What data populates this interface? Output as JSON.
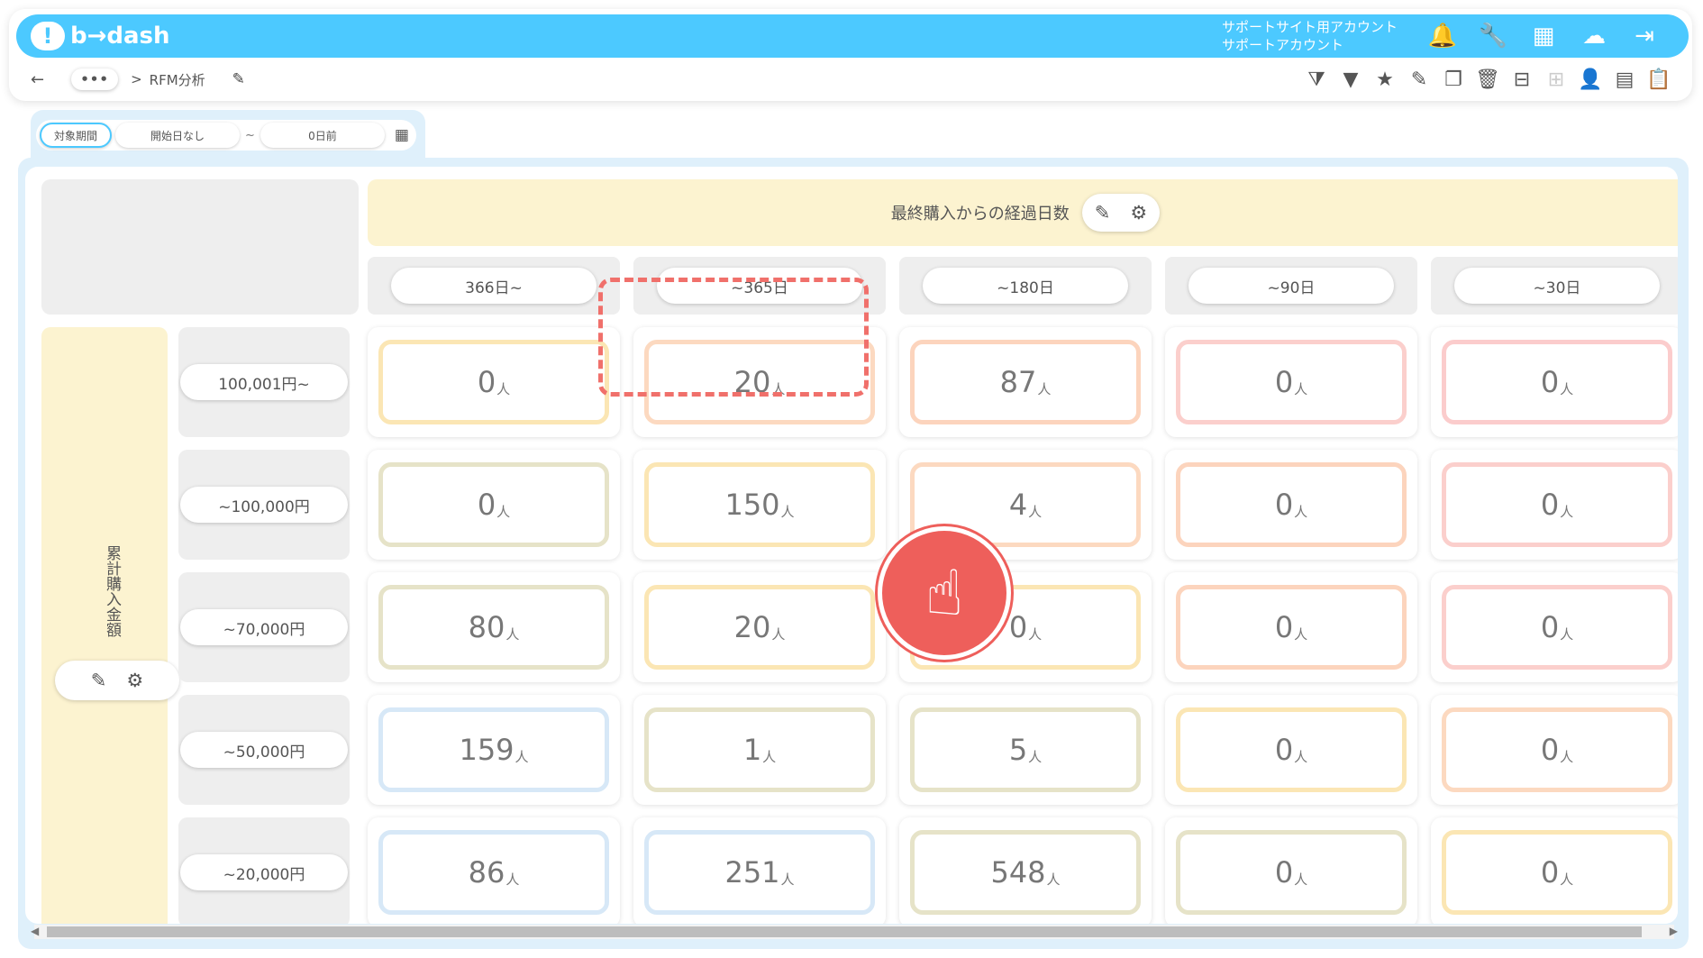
{
  "app": {
    "logo": "b→dash",
    "account_lines": [
      "サポートサイト用アカウント",
      "サポートアカウント"
    ],
    "top_icons": [
      "bell-icon",
      "wrench-icon",
      "apps-grid-icon",
      "support-chat-icon",
      "logout-icon"
    ]
  },
  "breadcrumb": {
    "back": "←",
    "more": "•••",
    "separator": ">",
    "current": "RFM分析"
  },
  "toolbar": {
    "icons": [
      "filter-clear-icon",
      "filter-icon",
      "star-icon",
      "edit-icon",
      "copy-icon",
      "delete-icon",
      "archive-icon",
      "unarchive-icon",
      "user-check-icon",
      "document-icon",
      "clipboard-icon"
    ]
  },
  "date_filter": {
    "label": "対象期間",
    "start": "開始日なし",
    "tilde": "~",
    "end": "0日前"
  },
  "column_axis": {
    "title": "最終購入からの経過日数",
    "columns": [
      "366日~",
      "~365日",
      "~180日",
      "~90日",
      "~30日"
    ]
  },
  "row_axis": {
    "title": "累計購入金額",
    "rows": [
      "100,001円~",
      "~100,000円",
      "~70,000円",
      "~50,000円",
      "~20,000円"
    ]
  },
  "unit": "人",
  "grid": {
    "values": [
      [
        "0",
        "20",
        "87",
        "0",
        "0"
      ],
      [
        "0",
        "150",
        "4",
        "0",
        "0"
      ],
      [
        "80",
        "20",
        "0",
        "0",
        "0"
      ],
      [
        "159",
        "1",
        "5",
        "0",
        "0"
      ],
      [
        "86",
        "251",
        "548",
        "0",
        "0"
      ]
    ],
    "border_colors": [
      [
        "#fbe6b4",
        "#fcd9c0",
        "#fcd4bd",
        "#fbcfcc",
        "#fbcccc"
      ],
      [
        "#e6e3c8",
        "#fbe6b4",
        "#fcd9c0",
        "#fcd4bd",
        "#fbcfcc"
      ],
      [
        "#e6e3c8",
        "#fbe6b4",
        "#fbe6b4",
        "#fcd4bd",
        "#fbcfcc"
      ],
      [
        "#d7e8f7",
        "#e6e3c8",
        "#e6e3c8",
        "#fbe6b4",
        "#fcd9c0"
      ],
      [
        "#d7e8f7",
        "#d7e8f7",
        "#e6e3c8",
        "#e6e3c8",
        "#fbe6b4"
      ]
    ]
  },
  "colors": {
    "brand": "#4cc9ff",
    "axis_bg": "#fcf3d0",
    "highlight": "#f0706b"
  }
}
